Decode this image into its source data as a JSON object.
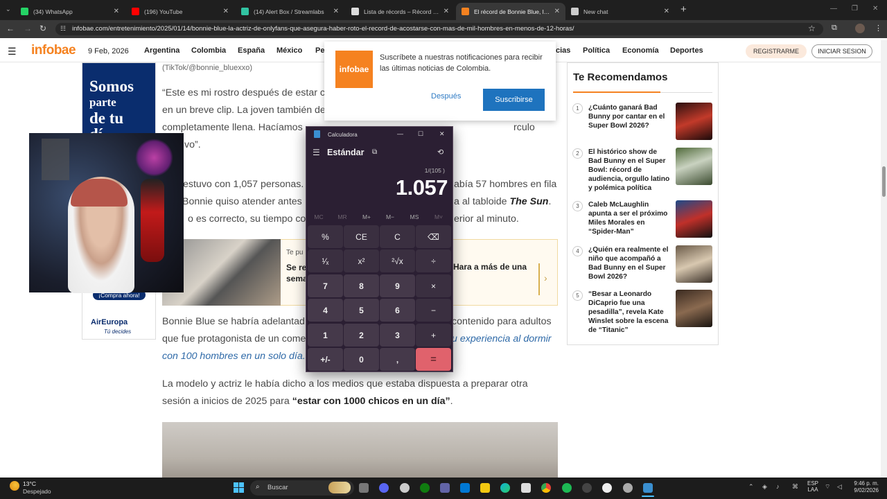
{
  "browser": {
    "tabs": [
      {
        "label": "(34) WhatsApp",
        "color": "#25d366"
      },
      {
        "label": "(196) YouTube",
        "color": "#ff0000"
      },
      {
        "label": "(14) Alert Box / Streamlabs",
        "color": "#31c3a2"
      },
      {
        "label": "Lista de récords – Récord mund",
        "color": "#dddddd"
      },
      {
        "label": "El récord de Bonnie Blue, la actr",
        "color": "#f58220"
      },
      {
        "label": "New chat",
        "color": "#cccccc"
      }
    ],
    "active_tab_index": 4,
    "url": "infobae.com/entretenimiento/2025/01/14/bonnie-blue-la-actriz-de-onlyfans-que-asegura-haber-roto-el-record-de-acostarse-con-mas-de-mil-hombres-en-menos-de-12-horas/"
  },
  "site": {
    "logo": "infobae",
    "date": "9 Feb, 2026",
    "nav": [
      "Argentina",
      "Colombia",
      "España",
      "México",
      "Pe",
      "cias",
      "Política",
      "Economía",
      "Deportes"
    ],
    "register": "REGISTRARME",
    "login": "INICIAR SESION"
  },
  "notification": {
    "logo": "infobae",
    "text": "Suscríbete a nuestras notificaciones para recibir las últimas noticias de Colombia.",
    "later": "Después",
    "subscribe": "Suscribirse"
  },
  "left_ad": {
    "line1": "Somos",
    "line2": "parte",
    "line3": "de tu",
    "line4": "dí",
    "buy": "¡Compra ahora!",
    "brand": "AirEuropa",
    "tagline": "Tú decides"
  },
  "article": {
    "caption": "(TikTok/@bonnie_bluexxo)",
    "p1": [
      "“Este es mi rostro después de estar c",
      "en un breve clip. La joven también de",
      "completamente llena. Hacíamos",
      "vo”."
    ],
    "p1_right": "rculo",
    "p2": [
      "estuvo con 1,057 personas.",
      "Bonnie quiso atender antes",
      "o es correcto, su tiempo co"
    ],
    "p2_right": [
      "abía 57 hombres en fila",
      "a al tabloide",
      "erior al minuto."
    ],
    "p2_bold": "The Sun",
    "related": {
      "tag": "Te pu",
      "title_left": [
        "Se re",
        "sema"
      ],
      "title_right": "Hara a más de una"
    },
    "p3": [
      "Bonnie Blue se habría adelantad",
      "que fue protagonista de un come",
      "con 100 hombres en un solo día."
    ],
    "p3_right": [
      "contenido para adultos",
      "u experiencia al dormir"
    ],
    "p4": [
      "La modelo y actriz le había dicho a los medios que estaba dispuesta a preparar otra",
      "sesión a inicios de 2025 para "
    ],
    "p4_bold": "“estar con 1000 chicos en un día”",
    "p4_end": "."
  },
  "recommended": {
    "title": "Te Recomendamos",
    "items": [
      {
        "num": "1",
        "title": "¿Cuánto ganará Bad Bunny por cantar en el Super Bowl 2026?"
      },
      {
        "num": "2",
        "title": "El histórico show de Bad Bunny en el Super Bowl: récord de audiencia, orgullo latino y polémica política"
      },
      {
        "num": "3",
        "title": "Caleb McLaughlin apunta a ser el próximo Miles Morales en “Spider-Man”"
      },
      {
        "num": "4",
        "title": "¿Quién era realmente el niño que acompañó a Bad Bunny en el Super Bowl 2026?"
      },
      {
        "num": "5",
        "title": "“Besar a Leonardo DiCaprio fue una pesadilla”, revela Kate Winslet sobre la escena de “Titanic”"
      }
    ]
  },
  "calculator": {
    "title": "Calculadora",
    "mode": "Estándar",
    "expression": "1/(105 )",
    "display": "1.057",
    "memory": [
      "MC",
      "MR",
      "M+",
      "M−",
      "MS",
      "M˅"
    ],
    "keys": [
      [
        "%",
        "CE",
        "C",
        "⌫"
      ],
      [
        "¹⁄ₓ",
        "x²",
        "²√x",
        "÷"
      ],
      [
        "7",
        "8",
        "9",
        "×"
      ],
      [
        "4",
        "5",
        "6",
        "−"
      ],
      [
        "1",
        "2",
        "3",
        "+"
      ],
      [
        "+/-",
        "0",
        ",",
        "="
      ]
    ]
  },
  "taskbar": {
    "temp": "13°C",
    "condition": "Despejado",
    "search": "Buscar",
    "lang": [
      "ESP",
      "LAA"
    ],
    "time": "9:46 p. m.",
    "date": "9/02/2026"
  }
}
